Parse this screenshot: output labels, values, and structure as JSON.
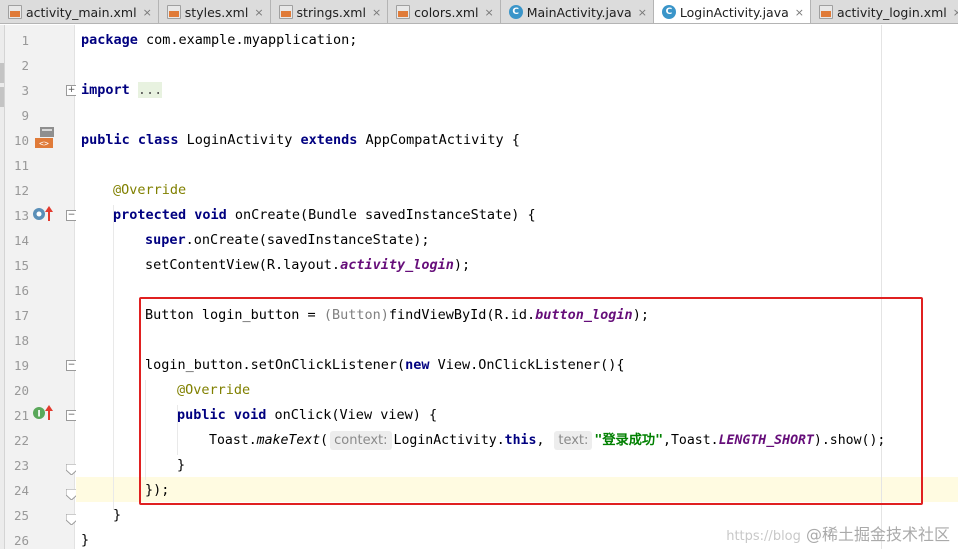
{
  "tabs": [
    {
      "label": "activity_main.xml",
      "type": "xml",
      "active": false
    },
    {
      "label": "styles.xml",
      "type": "xml",
      "active": false
    },
    {
      "label": "strings.xml",
      "type": "xml",
      "active": false
    },
    {
      "label": "colors.xml",
      "type": "xml",
      "active": false
    },
    {
      "label": "MainActivity.java",
      "type": "java",
      "active": false
    },
    {
      "label": "LoginActivity.java",
      "type": "java",
      "active": true
    },
    {
      "label": "activity_login.xml",
      "type": "xml",
      "active": false
    }
  ],
  "tab_close_glyph": "×",
  "line_numbers": [
    "1",
    "2",
    "3",
    "9",
    "10",
    "11",
    "12",
    "13",
    "14",
    "15",
    "16",
    "17",
    "18",
    "19",
    "20",
    "21",
    "22",
    "23",
    "24",
    "25",
    "26"
  ],
  "code": {
    "l1_kw": "package",
    "l1_rest": " com.example.myapplication;",
    "l3_kw": "import",
    "l3_dots": "...",
    "l10_kw1": "public class",
    "l10_name": " LoginActivity ",
    "l10_kw2": "extends",
    "l10_rest": " AppCompatActivity {",
    "l12_anno": "@Override",
    "l13_kw": "protected void",
    "l13_rest": " onCreate(Bundle savedInstanceState) {",
    "l14_kw": "super",
    "l14_rest": ".onCreate(savedInstanceState);",
    "l15_pre": "setContentView(R.layout.",
    "l15_field": "activity_login",
    "l15_post": ");",
    "l17_pre": "Button login_button = ",
    "l17_cast": "(Button)",
    "l17_mid": "findViewById(R.id.",
    "l17_field": "button_login",
    "l17_post": ");",
    "l19_pre": "login_button.setOnClickListener(",
    "l19_kw": "new",
    "l19_post": " View.OnClickListener(){",
    "l20_anno": "@Override",
    "l21_kw": "public void",
    "l21_rest": " onClick(View view) {",
    "l22_pre": "Toast.",
    "l22_static": "makeText",
    "l22_open": "(",
    "l22_hint1": "context:",
    "l22_ctx": "LoginActivity.",
    "l22_this": "this",
    "l22_comma": ",",
    "l22_hint2": "text:",
    "l22_str": "\"登录成功\"",
    "l22_mid": ",Toast.",
    "l22_field": "LENGTH_SHORT",
    "l22_post": ").show();",
    "l23": "}",
    "l24": "});",
    "l25": "}",
    "l26": "}"
  },
  "watermark": {
    "url": "https://blog",
    "text": "@稀土掘金技术社区"
  },
  "colors": {
    "keyword": "#000080",
    "annotation": "#808000",
    "field": "#660e7a",
    "string": "#008000",
    "highlight_box": "#e02020",
    "current_line": "#fffbe1"
  },
  "gutter_icons": [
    "class-layout-icon",
    "override-method-icon",
    "implement-method-icon"
  ]
}
